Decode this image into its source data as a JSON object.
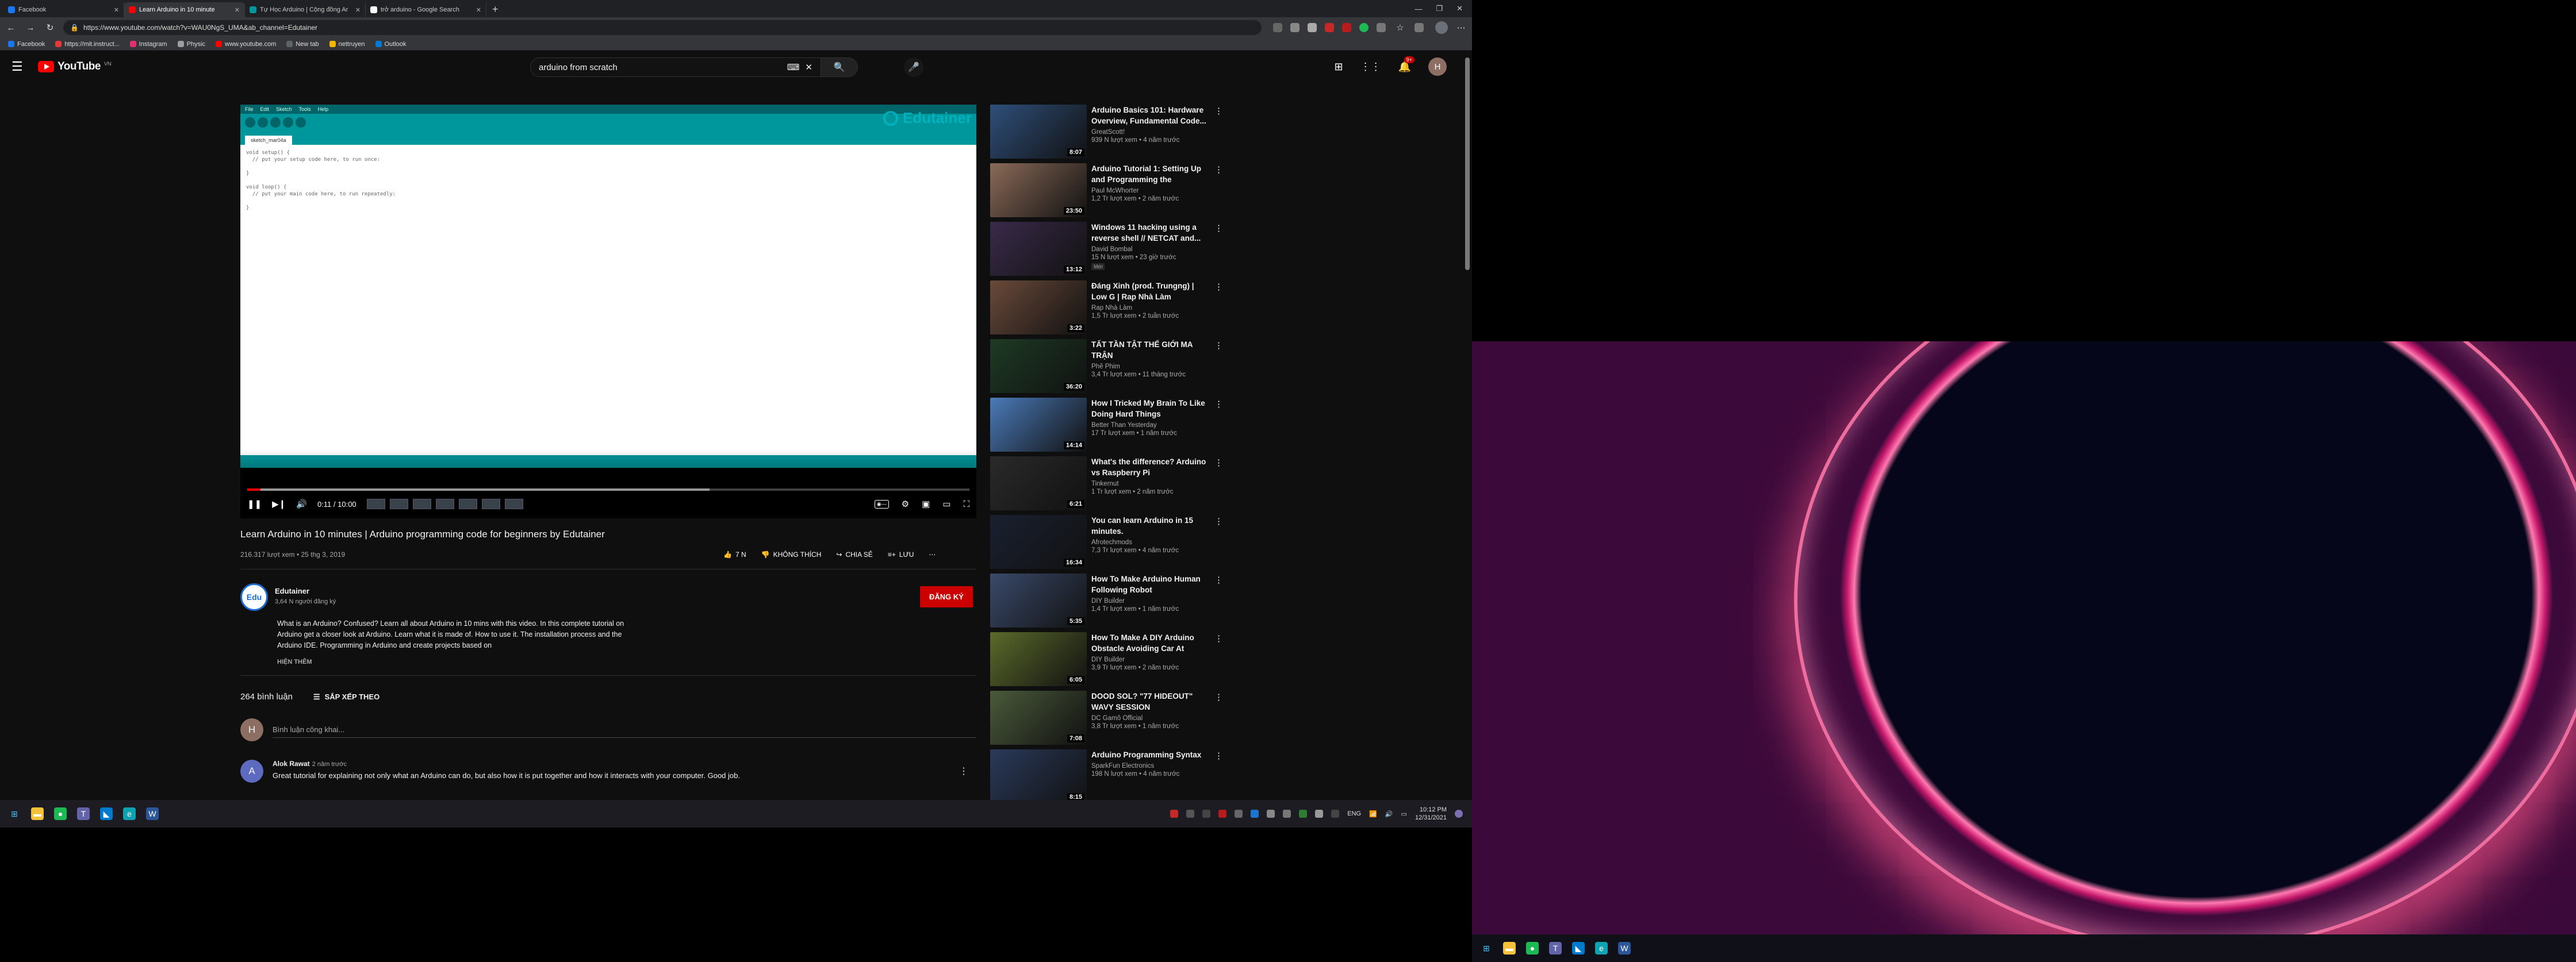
{
  "browser": {
    "tabs": [
      {
        "label": "Facebook",
        "color": "#1877f2",
        "active": false
      },
      {
        "label": "Learn Arduino in 10 minute",
        "color": "#ff0000",
        "active": true
      },
      {
        "label": "Tự Học Arduino | Cộng đồng Ar",
        "color": "#00979c",
        "active": false
      },
      {
        "label": "trở arduino - Google Search",
        "color": "#ffffff",
        "active": false
      }
    ],
    "url": "https://www.youtube.com/watch?v=WAU0NgS_UMA&ab_channel=Edutainer",
    "bookmarks": [
      {
        "label": "Facebook",
        "color": "#1877f2"
      },
      {
        "label": "https://mit.instruct...",
        "color": "#e53935"
      },
      {
        "label": "Instagram",
        "color": "#e1306c"
      },
      {
        "label": "Physic",
        "color": "#9e9e9e"
      },
      {
        "label": "www.youtube.com",
        "color": "#ff0000"
      },
      {
        "label": "New tab",
        "color": "#5f6368"
      },
      {
        "label": "nettruyen",
        "color": "#f2b600"
      },
      {
        "label": "Outlook",
        "color": "#0078d4"
      }
    ]
  },
  "youtube": {
    "logo_text": "YouTube",
    "country_code": "VN",
    "search_query": "arduino from scratch",
    "notification_count": "9+",
    "avatar_letter": "H"
  },
  "player": {
    "ide_menu": [
      "File",
      "Edit",
      "Sketch",
      "Tools",
      "Help"
    ],
    "file_tab": "sketch_mar04a",
    "code": "void setup() {\n  // put your setup code here, to run once:\n\n}\n\nvoid loop() {\n  // put your main code here, to run repeatedly:\n\n}",
    "watermark": "Edutainer",
    "time_current": "0:11",
    "time_total": "10:00",
    "progress": 0.018,
    "buffered": 0.64
  },
  "video": {
    "title": "Learn Arduino in 10 minutes | Arduino programming code for beginners by Edutainer",
    "meta": "216.317 lượt xem • 25 thg 3, 2019",
    "likes": "7 N",
    "dislike_label": "KHÔNG THÍCH",
    "share_label": "CHIA SẺ",
    "save_label": "LƯU"
  },
  "channel": {
    "name": "Edutainer",
    "subs": "3,64 N người đăng ký",
    "avatar_text": "Edu",
    "subscribe_label": "ĐĂNG KÝ"
  },
  "description": {
    "text": "What is an Arduino? Confused? Learn all about Arduino in 10 mins with this video. In this complete tutorial on Arduino get a closer look at Arduino. Learn what it is made of. How to use it. The installation process and the Arduino IDE. Programming in Arduino and create projects based on",
    "show_more": "HIỆN THÊM"
  },
  "comments": {
    "count_label": "264 bình luận",
    "sort_label": "SẮP XẾP THEO",
    "placeholder": "Bình luận công khai...",
    "user_letter": "H",
    "items": [
      {
        "letter": "A",
        "author": "Alok Rawat",
        "time": "2 năm trước",
        "text": "Great tutorial for explaining not only what an Arduino can do, but also how it is put together and how it interacts with your computer. Good job."
      }
    ]
  },
  "recommendations": [
    {
      "title": "Arduino Basics 101: Hardware Overview, Fundamental Code...",
      "channel": "GreatScott!",
      "stats": "939 N lượt xem • 4 năm trước",
      "duration": "8:07",
      "color": "#2f4f7a",
      "badge": ""
    },
    {
      "title": "Arduino Tutorial 1: Setting Up and Programming the Arduino...",
      "channel": "Paul McWhorter",
      "stats": "1,2 Tr lượt xem • 2 năm trước",
      "duration": "23:50",
      "color": "#8a6a58",
      "badge": ""
    },
    {
      "title": "Windows 11 hacking using a reverse shell // NETCAT and...",
      "channel": "David Bombal",
      "stats": "15 N lượt xem • 23 giờ trước",
      "duration": "13:12",
      "color": "#3a2a4a",
      "badge": "Mới"
    },
    {
      "title": "Đáng Xinh (prod. Trungng) | Low G | Rap Nhà Làm",
      "channel": "Rap Nhà Làm",
      "stats": "1,5 Tr lượt xem • 2 tuần trước",
      "duration": "3:22",
      "color": "#6a4a3a",
      "badge": ""
    },
    {
      "title": "TẤT TẦN TẬT THẾ GIỚI MA TRẬN",
      "channel": "Phê Phim",
      "stats": "3,4 Tr lượt xem • 11 tháng trước",
      "duration": "36:20",
      "color": "#1d3a24",
      "badge": ""
    },
    {
      "title": "How I Tricked My Brain To Like Doing Hard Things (dopamine...",
      "channel": "Better Than Yesterday",
      "stats": "17 Tr lượt xem • 1 năm trước",
      "duration": "14:14",
      "color": "#4a7ab8",
      "badge": ""
    },
    {
      "title": "What's the difference? Arduino vs Raspberry Pi",
      "channel": "Tinkernut",
      "stats": "1 Tr lượt xem • 2 năm trước",
      "duration": "6:21",
      "color": "#2a2a2a",
      "badge": ""
    },
    {
      "title": "You can learn Arduino in 15 minutes.",
      "channel": "Afrotechmods",
      "stats": "7,3 Tr lượt xem • 4 năm trước",
      "duration": "16:34",
      "color": "#1a2030",
      "badge": ""
    },
    {
      "title": "How To Make Arduino Human Following Robot",
      "channel": "DIY Builder",
      "stats": "1,4 Tr lượt xem • 1 năm trước",
      "duration": "5:35",
      "color": "#3a4a6a",
      "badge": ""
    },
    {
      "title": "How To Make A DIY Arduino Obstacle Avoiding Car At Home",
      "channel": "DIY Builder",
      "stats": "3,9 Tr lượt xem • 2 năm trước",
      "duration": "6:05",
      "color": "#5a6a2a",
      "badge": ""
    },
    {
      "title": "DOOD SOL? \"77 HIDEOUT\" WAVY SESSION",
      "channel": "DC Gamô Official",
      "stats": "3,8 Tr lượt xem • 1 năm trước",
      "duration": "7:08",
      "color": "#4a5a3a",
      "badge": ""
    },
    {
      "title": "Arduino Programming Syntax",
      "channel": "SparkFun Electronics",
      "stats": "198 N lượt xem • 4 năm trước",
      "duration": "8:15",
      "color": "#2a3a5a",
      "badge": ""
    }
  ],
  "taskbar": {
    "apps": [
      {
        "icon": "windows-icon",
        "color": "#4cc2ff"
      },
      {
        "icon": "folder-icon",
        "color": "#f3c13a"
      },
      {
        "icon": "spotify-icon",
        "color": "#1db954"
      },
      {
        "icon": "teams-icon",
        "color": "#6264a7"
      },
      {
        "icon": "vscode-icon",
        "color": "#007acc"
      },
      {
        "icon": "edge-icon",
        "color": "#0fa3b1"
      },
      {
        "icon": "word-icon",
        "color": "#2b579a"
      }
    ],
    "language": "ENG",
    "time": "10:12 PM",
    "date": "12/31/2021"
  }
}
